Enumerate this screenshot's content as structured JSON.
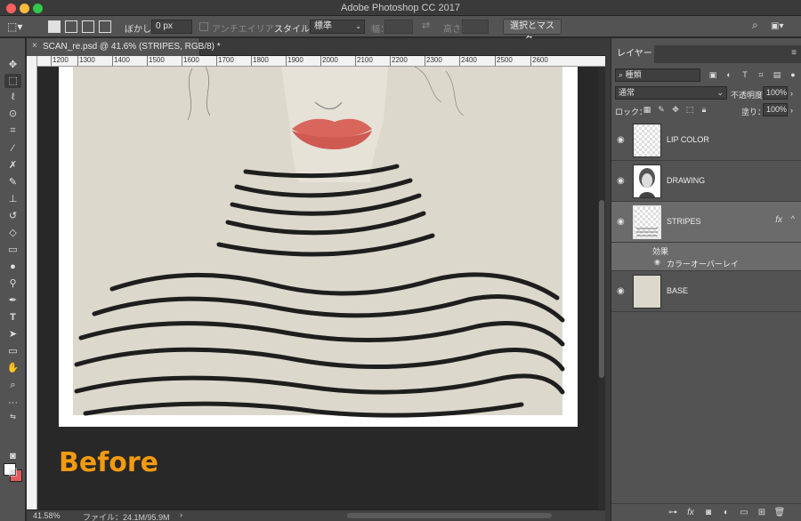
{
  "window": {
    "title": "Adobe Photoshop CC 2017"
  },
  "options_bar": {
    "feather_label": "ぼかし：",
    "feather_value": "0 px",
    "antialias_label": "アンチエイリアス",
    "style_label": "スタイル：",
    "style_value": "標準",
    "width_label": "幅：",
    "height_label": "高さ：",
    "select_mask_button": "選択とマスク..."
  },
  "document": {
    "tab_label": "SCAN_re.psd @ 41.6% (STRIPES, RGB/8) *",
    "ruler_ticks": [
      "1200",
      "1300",
      "1400",
      "1500",
      "1600",
      "1700",
      "1800",
      "1900",
      "2000",
      "2100",
      "2200",
      "2300",
      "2400",
      "2500",
      "2600"
    ],
    "overlay_text": "Before"
  },
  "status_bar": {
    "zoom": "41.58%",
    "file_info": "ファイル：24.1M/95.9M",
    "arrow": "›"
  },
  "layers_panel": {
    "tab": "レイヤー",
    "filter_kind": "種類",
    "blend_mode": "通常",
    "opacity_label": "不透明度：",
    "opacity_value": "100%",
    "lock_label": "ロック：",
    "fill_label": "塗り：",
    "fill_value": "100%",
    "effects_label": "効果",
    "effect_name": "カラーオーバーレイ",
    "fx": "fx",
    "layers": [
      {
        "name": "LIP COLOR"
      },
      {
        "name": "DRAWING"
      },
      {
        "name": "STRIPES"
      },
      {
        "name": "BASE"
      }
    ]
  },
  "colors": {
    "accent_orange": "#f29a10",
    "background_swatch": "#e55b5b",
    "panel_bg": "#535353"
  }
}
